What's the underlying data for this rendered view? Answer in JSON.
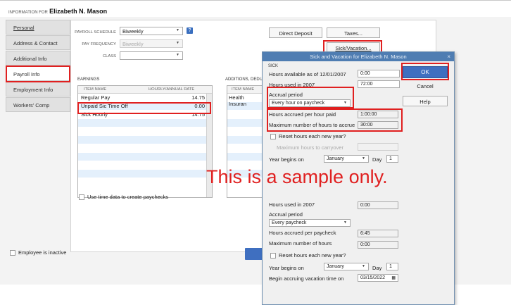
{
  "header": {
    "info_label": "INFORMATION FOR",
    "employee_name": "Elizabeth N. Mason"
  },
  "tabs": [
    {
      "label": "Personal"
    },
    {
      "label": "Address & Contact"
    },
    {
      "label": "Additional Info"
    },
    {
      "label": "Payroll Info"
    },
    {
      "label": "Employment Info"
    },
    {
      "label": "Workers' Comp"
    }
  ],
  "payroll": {
    "schedule_label": "PAYROLL SCHEDULE",
    "schedule_value": "Biweekly",
    "frequency_label": "PAY FREQUENCY",
    "frequency_value": "Biweekly",
    "class_label": "CLASS",
    "class_value": "",
    "direct_deposit": "Direct Deposit",
    "taxes": "Taxes...",
    "sick_vacation": "Sick/Vacation..."
  },
  "earnings": {
    "section_label": "EARNINGS",
    "col_item": "ITEM NAME",
    "col_rate": "HOURLY/ANNUAL RATE",
    "rows": [
      {
        "name": "Regular Pay",
        "rate": "14.75"
      },
      {
        "name": "Unpaid Sic Time Off",
        "rate": "0.00"
      },
      {
        "name": "Sick Hourly",
        "rate": "14.75"
      }
    ]
  },
  "additions": {
    "section_label": "ADDITIONS, DEDU",
    "col_item": "ITEM NAME",
    "rows": [
      {
        "name": "Health Insuran"
      }
    ]
  },
  "use_time_data": "Use time data to create paychecks",
  "employee_inactive": "Employee is inactive",
  "dialog": {
    "title": "Sick and Vacation for Elizabeth N. Mason",
    "ok": "OK",
    "cancel": "Cancel",
    "help": "Help",
    "sick": {
      "section_label": "SICK",
      "hours_available_label": "Hours available as of 12/01/2007",
      "hours_available_value": "0:00",
      "hours_used_label": "Hours used in 2007",
      "hours_used_value": "72:00",
      "accrual_period_label": "Accrual period",
      "accrual_period_value": "Every hour on paycheck",
      "hours_accrued_label": "Hours accrued per hour paid",
      "hours_accrued_value": "1:00:00",
      "max_hours_label": "Maximum number of hours to accrue",
      "max_hours_value": "30:00",
      "reset_label": "Reset hours each new year?",
      "carryover_label": "Maximum hours to carryover",
      "year_begins_label": "Year begins on",
      "year_begins_month": "January",
      "day_label": "Day",
      "day_value": "1"
    },
    "vacation": {
      "hours_used_label": "Hours used in 2007",
      "hours_used_value": "0:00",
      "accrual_period_label": "Accrual period",
      "accrual_period_value": "Every paycheck",
      "hours_accrued_label": "Hours accrued per paycheck",
      "hours_accrued_value": "6:45",
      "max_hours_label": "Maximum number of hours",
      "max_hours_value": "0:00",
      "reset_label": "Reset hours each new year?",
      "year_begins_label": "Year begins on",
      "year_begins_month": "January",
      "day_label": "Day",
      "day_value": "1",
      "begin_accruing_label": "Begin accruing vacation time on",
      "begin_accruing_value": "03/15/2022"
    }
  },
  "watermark": "This is a sample only.",
  "colors": {
    "ok_button": "#3f6fc0",
    "dialog_title": "#4f7db2",
    "highlight_red": "#e02020",
    "selected_row": "#e4f0fc"
  }
}
